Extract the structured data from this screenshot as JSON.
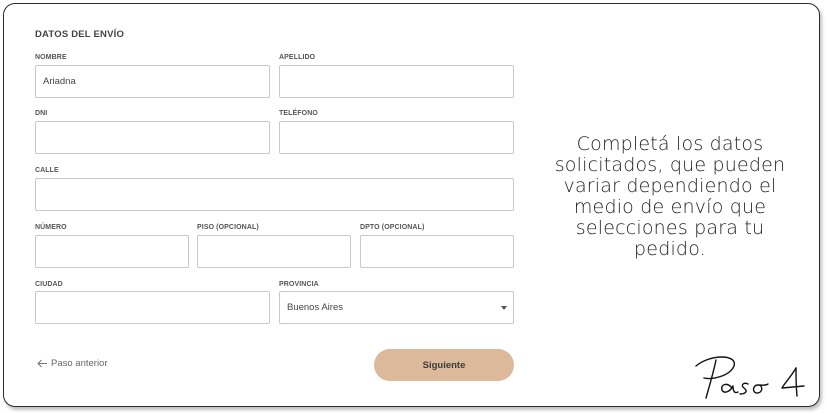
{
  "form": {
    "section_title": "DATOS DEL ENVÍO",
    "nombre": {
      "label": "NOMBRE",
      "value": "Ariadna"
    },
    "apellido": {
      "label": "APELLIDO",
      "value": ""
    },
    "dni": {
      "label": "DNI",
      "value": ""
    },
    "telefono": {
      "label": "TELÉFONO",
      "value": ""
    },
    "calle": {
      "label": "CALLE",
      "value": ""
    },
    "numero": {
      "label": "NÚMERO",
      "value": ""
    },
    "piso": {
      "label": "PISO (OPCIONAL)",
      "value": ""
    },
    "dpto": {
      "label": "DPTO (OPCIONAL)",
      "value": ""
    },
    "ciudad": {
      "label": "CIUDAD",
      "value": ""
    },
    "provincia": {
      "label": "PROVINCIA",
      "value": "Buenos Aires"
    }
  },
  "nav": {
    "back_label": "Paso anterior",
    "next_label": "Siguiente",
    "next_color": "#dbb99a"
  },
  "side_note": "Completá los datos solicitados, que pueden variar dependiendo el medio de envío que selecciones para tu pedido.",
  "step_label": "Paso 4",
  "icons": {
    "back": "arrow-left-icon",
    "select": "chevron-down-icon"
  }
}
